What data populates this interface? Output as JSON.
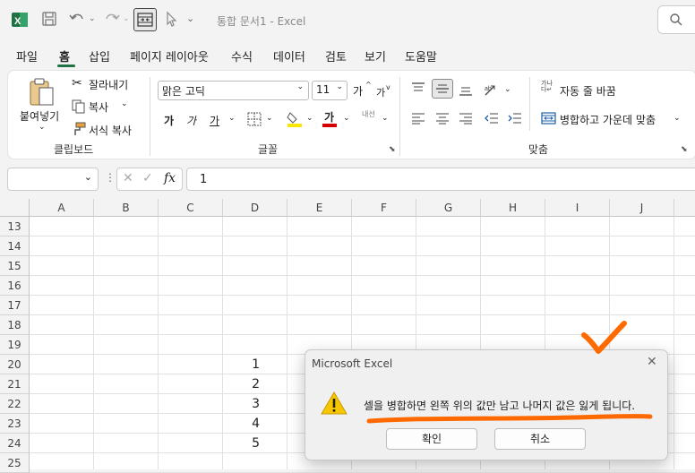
{
  "titlebar": {
    "title": "통합 문서1  -  Excel"
  },
  "menu": {
    "tabs": [
      "파일",
      "홈",
      "삽입",
      "페이지 레이아웃",
      "수식",
      "데이터",
      "검토",
      "보기",
      "도움말"
    ],
    "active_tab": "홈"
  },
  "ribbon": {
    "clipboard": {
      "paste": "붙여넣기",
      "cut": "잘라내기",
      "copy": "복사",
      "format_painter": "서식 복사",
      "group_label": "클립보드"
    },
    "font": {
      "font_name": "맑은 고딕",
      "font_size": "11",
      "bold": "가",
      "italic": "가",
      "underline": "가",
      "font_color_glyph": "가",
      "phonetic": "내선",
      "grow_font": "가",
      "shrink_font": "가",
      "group_label": "글꼴"
    },
    "alignment": {
      "wrap_text": "자동 줄 바꿈",
      "merge_center": "병합하고 가운데 맞춤",
      "group_label": "맞춤"
    }
  },
  "formula_bar": {
    "name_box": "",
    "fx": "fx",
    "value": "1"
  },
  "grid": {
    "columns": [
      "A",
      "B",
      "C",
      "D",
      "E",
      "F",
      "G",
      "H",
      "I",
      "J"
    ],
    "rows": [
      "13",
      "14",
      "15",
      "16",
      "17",
      "18",
      "19",
      "20",
      "21",
      "22",
      "23",
      "24",
      "25"
    ],
    "column_d_values": [
      "1",
      "2",
      "3",
      "4",
      "5"
    ]
  },
  "dialog": {
    "title": "Microsoft Excel",
    "message": "셀을 병합하면 왼쪽 위의 값만 남고 나머지 값은 잃게 됩니다.",
    "ok_label": "확인",
    "cancel_label": "취소"
  },
  "colors": {
    "excel_green": "#1f7244",
    "annotation_orange": "#ff6a00",
    "warning_yellow": "#f6c700"
  }
}
